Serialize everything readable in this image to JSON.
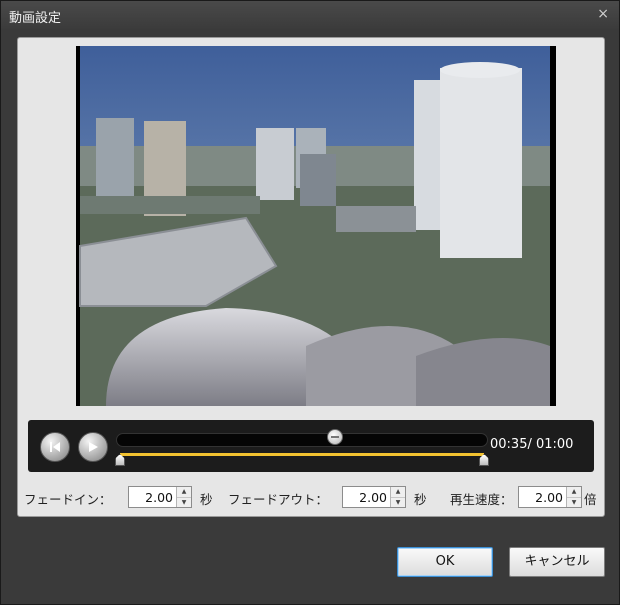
{
  "window": {
    "title": "動画設定",
    "close_glyph": "×"
  },
  "player": {
    "time": "00:35/ 01:00",
    "playhead_fraction": 0.59,
    "trim_start_fraction": 0.0,
    "trim_end_fraction": 1.0
  },
  "fade_in": {
    "label": "フェードイン：",
    "value": "2.00",
    "unit": "秒"
  },
  "fade_out": {
    "label": "フェードアウト：",
    "value": "2.00",
    "unit": "秒"
  },
  "speed": {
    "label": "再生速度：",
    "value": "2.00",
    "unit": "倍"
  },
  "buttons": {
    "ok": "OK",
    "cancel": "キャンセル"
  },
  "icons": {
    "prev": "skip-back-icon",
    "play": "play-icon"
  }
}
